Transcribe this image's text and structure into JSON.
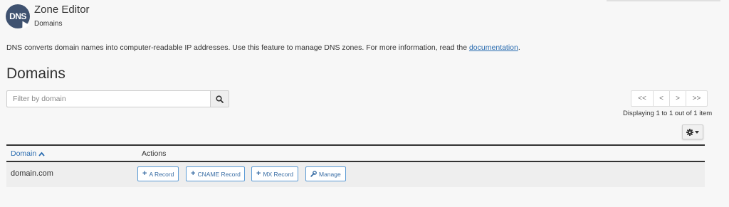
{
  "header": {
    "app_icon_label": "DNS",
    "title": "Zone Editor",
    "subtitle": "Domains"
  },
  "intro": {
    "text": "DNS converts domain names into computer-readable IP addresses. Use this feature to manage DNS zones. For more information, read the ",
    "link_text": "documentation",
    "suffix": "."
  },
  "page_heading": "Domains",
  "search": {
    "placeholder": "Filter by domain",
    "value": "",
    "icon": "search-icon"
  },
  "pagination": {
    "first": "<<",
    "prev": "<",
    "next": ">",
    "last": ">>",
    "status": "Displaying 1 to 1 out of 1 item"
  },
  "settings": {
    "icon": "gear-icon"
  },
  "table": {
    "columns": [
      {
        "label": "Domain",
        "sort": "ascending"
      },
      {
        "label": "Actions"
      }
    ],
    "rows": [
      {
        "domain": "domain.com",
        "actions": {
          "a_record": "A Record",
          "cname_record": "CNAME Record",
          "mx_record": "MX Record",
          "manage": "Manage"
        }
      }
    ]
  },
  "colors": {
    "link": "#2a6cb0",
    "button_border": "#5b9bd5",
    "row_bg": "#eeeeee",
    "page_bg": "#f7f7f7"
  }
}
